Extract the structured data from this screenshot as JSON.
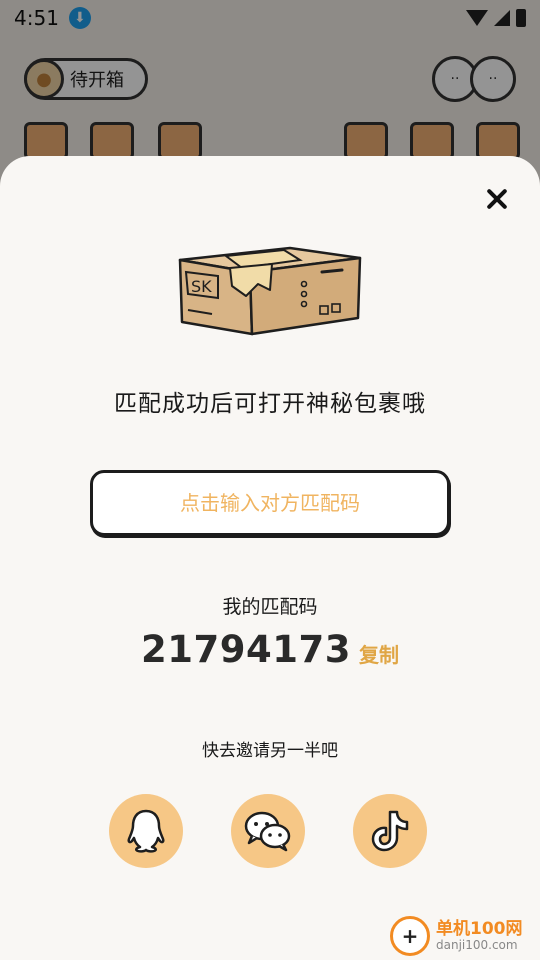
{
  "status_bar": {
    "time": "4:51",
    "download_icon": "download-arrow-icon"
  },
  "background": {
    "pending_label": "待开箱",
    "icons": [
      "house-icon",
      "shirt-icon",
      "shop-icon",
      "flag-icon",
      "badge-icon",
      "calendar-icon"
    ]
  },
  "sheet": {
    "close_icon": "close-icon",
    "box_text": "SK",
    "title": "匹配成功后可打开神秘包裹哦",
    "input_placeholder": "点击输入对方匹配码",
    "my_code_label": "我的匹配码",
    "my_code_value": "21794173",
    "copy_label": "复制",
    "invite_label": "快去邀请另一半吧",
    "share_icons": [
      "qq-icon",
      "wechat-icon",
      "tiktok-icon"
    ]
  },
  "watermark": {
    "name": "单机100网",
    "domain": "danji100.com"
  },
  "colors": {
    "accent": "#e0a645",
    "placeholder": "#f0b460",
    "share_button_bg": "#f6c786",
    "sheet_bg": "#f9f7f4"
  }
}
